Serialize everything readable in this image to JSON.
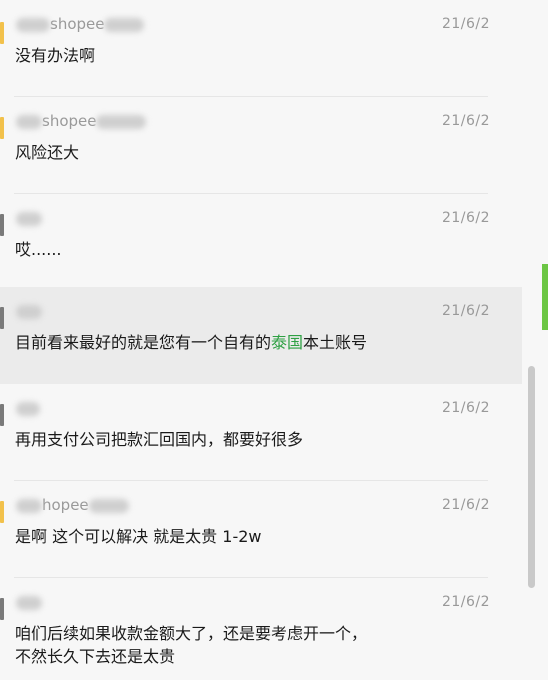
{
  "messages": [
    {
      "sender": "shopee",
      "date": "21/6/2",
      "text": "没有办法啊"
    },
    {
      "sender": "shopee",
      "date": "21/6/2",
      "text": "风险还大"
    },
    {
      "sender": "",
      "date": "21/6/2",
      "text": "哎......"
    },
    {
      "sender": "",
      "date": "21/6/2",
      "text_parts": [
        "目前看来最好的就是您有一个自有的",
        "泰国",
        "本土账号"
      ]
    },
    {
      "sender": "",
      "date": "21/6/2",
      "text": "再用支付公司把款汇回国内，都要好很多"
    },
    {
      "sender": "hopee",
      "date": "21/6/2",
      "text": "是啊 这个可以解决 就是太贵 1-2w"
    },
    {
      "sender": "",
      "date": "21/6/2",
      "text_lines": [
        "咱们后续如果收款金额大了，还是要考虑开一个，",
        "不然长久下去还是太贵"
      ]
    }
  ],
  "colors": {
    "accent_green": "#2ea043",
    "avatar_yellow": "#f2c14b",
    "avatar_gray": "#7a7a7a",
    "scrollbar_green": "#6cc644"
  }
}
